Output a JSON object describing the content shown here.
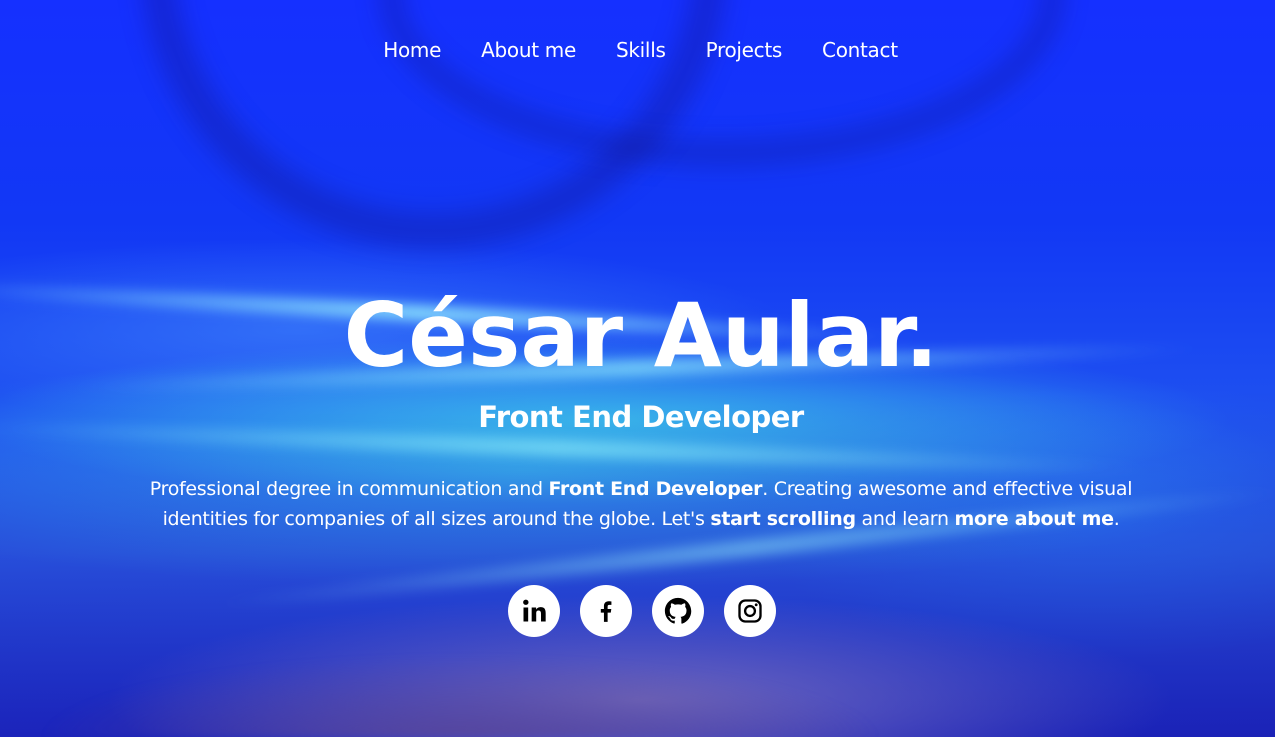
{
  "nav": {
    "items": [
      {
        "label": "Home"
      },
      {
        "label": "About me"
      },
      {
        "label": "Skills"
      },
      {
        "label": "Projects"
      },
      {
        "label": "Contact"
      }
    ]
  },
  "hero": {
    "title": "César Aular.",
    "subtitle": "Front End Developer",
    "bio": {
      "part1": "Professional degree in communication and ",
      "bold1": "Front End Developer",
      "part2": ". Creating awesome and effective visual identities for companies of all sizes around the globe. Let's ",
      "bold2": "start scrolling",
      "part3": " and learn ",
      "bold3": "more about me",
      "part4": "."
    }
  },
  "socials": [
    {
      "icon": "linkedin-icon"
    },
    {
      "icon": "facebook-icon"
    },
    {
      "icon": "github-icon"
    },
    {
      "icon": "instagram-icon"
    }
  ],
  "colors": {
    "background_primary": "#1530ff",
    "text": "#ffffff",
    "icon_bg": "#ffffff",
    "icon_fg": "#000000"
  }
}
